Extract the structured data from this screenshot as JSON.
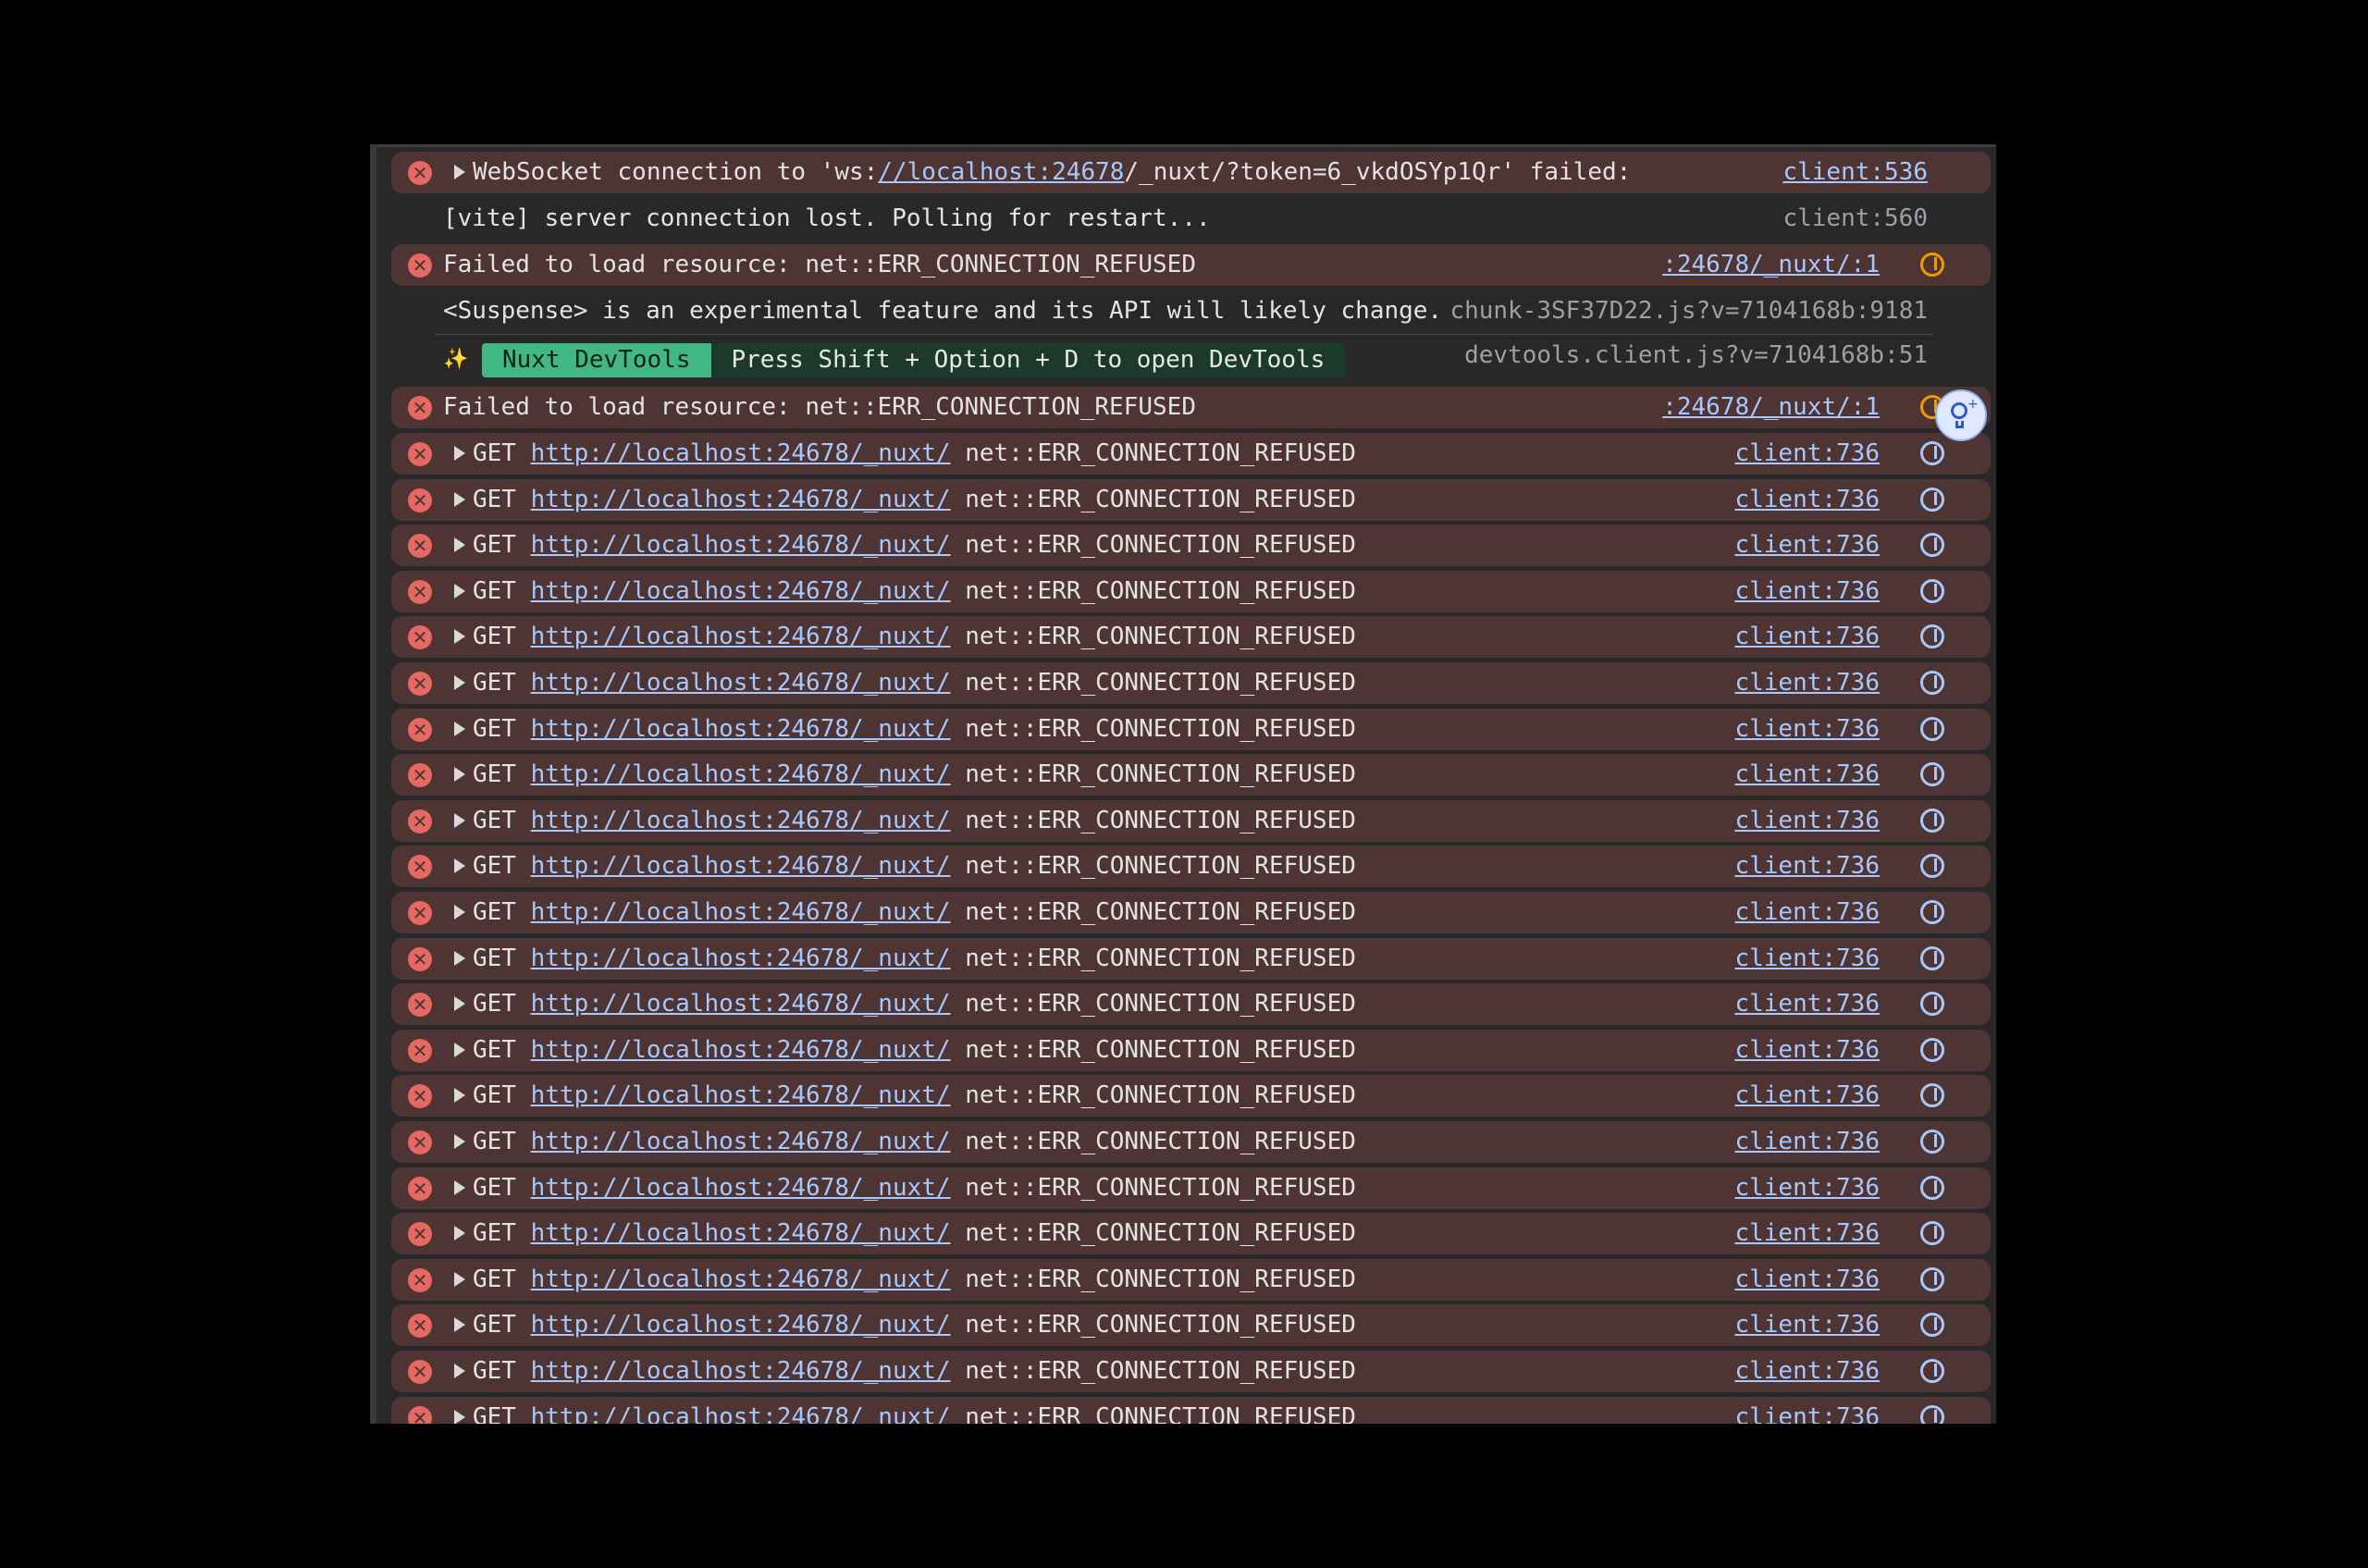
{
  "console": {
    "websocket_row": {
      "prefix": "WebSocket connection to 'ws:",
      "url": "//localhost:24678",
      "suffix": "/_nuxt/?token=6_vkdOSYp1Qr' failed:",
      "source": "client:536"
    },
    "vite_row": {
      "message": "[vite] server connection lost. Polling for restart...",
      "source": "client:560"
    },
    "failed_row_1": {
      "message": "Failed to load resource: net::ERR_CONNECTION_REFUSED",
      "source": ":24678/_nuxt/:1"
    },
    "suspense_row": {
      "message": "<Suspense> is an experimental feature and its API will likely change.",
      "source": "chunk-3SF37D22.js?v=7104168b:9181"
    },
    "devtools_row": {
      "sparkle": "✨",
      "badge": "Nuxt DevTools",
      "hint": "Press Shift + Option + D to open DevTools",
      "source": "devtools.client.js?v=7104168b:51"
    },
    "failed_row_2": {
      "message": "Failed to load resource: net::ERR_CONNECTION_REFUSED",
      "source": ":24678/_nuxt/:1"
    },
    "get_rows": {
      "method": "GET",
      "url": "http://localhost:24678/_nuxt/",
      "error": "net::ERR_CONNECTION_REFUSED",
      "source": "client:736",
      "count": 22
    }
  },
  "colors": {
    "error_bg": "#4e3433",
    "error_icon": "#e46962",
    "link": "#a8c7fa",
    "nuxt_green": "#41b883"
  }
}
